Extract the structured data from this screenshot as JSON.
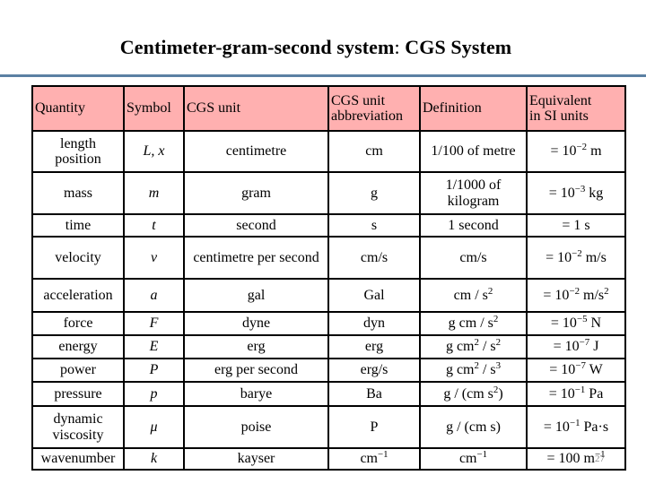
{
  "slide": {
    "title_main": "Centimeter-gram-second system",
    "title_colon": ": ",
    "title_sub": "CGS System",
    "page_number": "27",
    "accent_color": "#5b80a3",
    "header_bg_color": "#ffb0b0"
  },
  "table": {
    "headers": [
      "Quantity",
      "Symbol",
      "CGS unit",
      "CGS unit abbreviation",
      "Definition",
      "Equivalent in SI units"
    ],
    "header_lines": {
      "abbreviation": [
        "CGS unit",
        "abbreviation"
      ],
      "equivalent": [
        "Equivalent",
        "in SI units"
      ]
    },
    "rows": [
      {
        "quantity": [
          "length",
          "position"
        ],
        "symbol": "L, x",
        "unit": "centimetre",
        "abbr": "cm",
        "abbr_sup": "",
        "definition": "1/100 of metre",
        "def_parts": [],
        "si_pre": "= 10",
        "si_exp": "−2",
        "si_post": " m",
        "si_post_sup": ""
      },
      {
        "quantity": [
          "mass"
        ],
        "symbol": "m",
        "unit": "gram",
        "abbr": "g",
        "abbr_sup": "",
        "definition": "1/1000 of kilogram",
        "def_parts": [],
        "si_pre": "= 10",
        "si_exp": "−3",
        "si_post": " kg",
        "si_post_sup": ""
      },
      {
        "quantity": [
          "time"
        ],
        "symbol": "t",
        "unit": "second",
        "abbr": "s",
        "abbr_sup": "",
        "definition": "1 second",
        "def_parts": [],
        "si_pre": "= 1 s",
        "si_exp": "",
        "si_post": "",
        "si_post_sup": ""
      },
      {
        "quantity": [
          "velocity"
        ],
        "symbol": "v",
        "unit": "centimetre per second",
        "abbr": "cm/s",
        "abbr_sup": "",
        "definition": "cm/s",
        "def_parts": [],
        "si_pre": "= 10",
        "si_exp": "−2",
        "si_post": " m/s",
        "si_post_sup": ""
      },
      {
        "quantity": [
          "acceleration"
        ],
        "symbol": "a",
        "unit": "gal",
        "abbr": "Gal",
        "abbr_sup": "",
        "definition": "cm / s2",
        "def_parts": [
          "cm / s",
          "2",
          ""
        ],
        "si_pre": "= 10",
        "si_exp": "−2",
        "si_post": " m/s",
        "si_post_sup": "2"
      },
      {
        "quantity": [
          "force"
        ],
        "symbol": "F",
        "unit": "dyne",
        "abbr": "dyn",
        "abbr_sup": "",
        "definition": "g cm / s2",
        "def_parts": [
          "g cm / s",
          "2",
          ""
        ],
        "si_pre": "= 10",
        "si_exp": "−5",
        "si_post": " N",
        "si_post_sup": ""
      },
      {
        "quantity": [
          "energy"
        ],
        "symbol": "E",
        "unit": "erg",
        "abbr": "erg",
        "abbr_sup": "",
        "definition": "g cm2 / s2",
        "def_parts": [
          "g cm",
          "2",
          " / s",
          "2",
          ""
        ],
        "si_pre": "= 10",
        "si_exp": "−7",
        "si_post": " J",
        "si_post_sup": ""
      },
      {
        "quantity": [
          "power"
        ],
        "symbol": "P",
        "unit": "erg per second",
        "abbr": "erg/s",
        "abbr_sup": "",
        "definition": "g cm2 / s3",
        "def_parts": [
          "g cm",
          "2",
          " / s",
          "3",
          ""
        ],
        "si_pre": "= 10",
        "si_exp": "−7",
        "si_post": " W",
        "si_post_sup": ""
      },
      {
        "quantity": [
          "pressure"
        ],
        "symbol": "p",
        "unit": "barye",
        "abbr": "Ba",
        "abbr_sup": "",
        "definition": "g / (cm s2)",
        "def_parts": [
          "g / (cm s",
          "2",
          ")"
        ],
        "si_pre": "= 10",
        "si_exp": "−1",
        "si_post": " Pa",
        "si_post_sup": ""
      },
      {
        "quantity": [
          "dynamic",
          "viscosity"
        ],
        "symbol": "μ",
        "unit": "poise",
        "abbr": "P",
        "abbr_sup": "",
        "definition": "g / (cm s)",
        "def_parts": [],
        "si_pre": "= 10",
        "si_exp": "−1",
        "si_post": " Pa·s",
        "si_post_sup": ""
      },
      {
        "quantity": [
          "wavenumber"
        ],
        "symbol": "k",
        "unit": "kayser",
        "abbr": "cm",
        "abbr_sup": "−1",
        "definition": "cm−1",
        "def_parts": [
          "cm",
          "−1",
          ""
        ],
        "si_pre": "= 100 m",
        "si_exp": "",
        "si_post": "",
        "si_post_sup": "−1"
      }
    ]
  }
}
